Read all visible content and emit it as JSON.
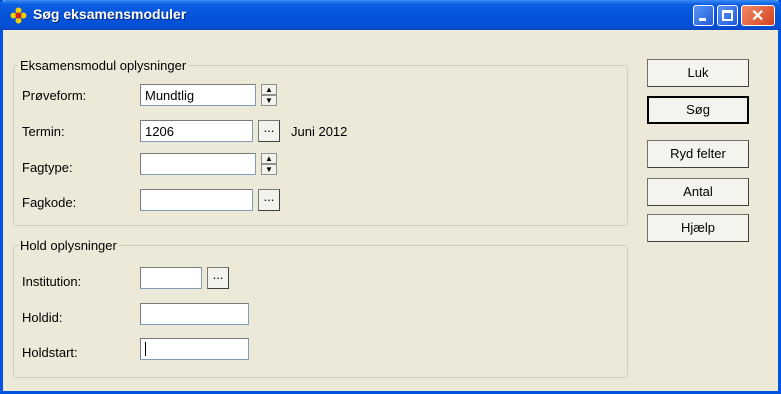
{
  "window": {
    "title": "Søg eksamensmoduler",
    "icon": "flower-icon"
  },
  "group_exam": {
    "legend": "Eksamensmodul oplysninger",
    "fields": {
      "proeveform": {
        "label": "Prøveform:",
        "value": "Mundtlig"
      },
      "termin": {
        "label": "Termin:",
        "value": "1206",
        "info": "Juni 2012"
      },
      "fagtype": {
        "label": "Fagtype:",
        "value": ""
      },
      "fagkode": {
        "label": "Fagkode:",
        "value": ""
      }
    }
  },
  "group_hold": {
    "legend": "Hold oplysninger",
    "fields": {
      "institution": {
        "label": "Institution:",
        "value": ""
      },
      "holdid": {
        "label": "Holdid:",
        "value": ""
      },
      "holdstart": {
        "label": "Holdstart:",
        "value": ""
      }
    }
  },
  "buttons": {
    "luk": "Luk",
    "soeg": "Søg",
    "ryd": "Ryd felter",
    "antal": "Antal",
    "hjaelp": "Hjælp"
  },
  "browse_label": "..."
}
